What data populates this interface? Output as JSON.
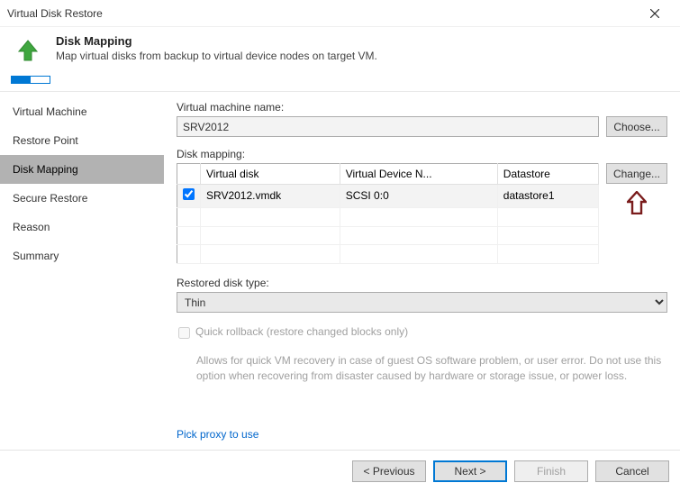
{
  "window": {
    "title": "Virtual Disk Restore"
  },
  "header": {
    "title": "Disk Mapping",
    "subtitle": "Map virtual disks from backup to virtual device nodes on target VM."
  },
  "sidebar": {
    "items": [
      {
        "label": "Virtual Machine"
      },
      {
        "label": "Restore Point"
      },
      {
        "label": "Disk Mapping"
      },
      {
        "label": "Secure Restore"
      },
      {
        "label": "Reason"
      },
      {
        "label": "Summary"
      }
    ],
    "active_index": 2
  },
  "content": {
    "vm_name_label": "Virtual machine name:",
    "vm_name_value": "SRV2012",
    "choose_label": "Choose...",
    "disk_mapping_label": "Disk mapping:",
    "table_headers": {
      "c0": "",
      "c1": "Virtual disk",
      "c2": "Virtual Device N...",
      "c3": "Datastore"
    },
    "rows": [
      {
        "checked": true,
        "disk": "SRV2012.vmdk",
        "node": "SCSI 0:0",
        "ds": "datastore1"
      }
    ],
    "change_label": "Change...",
    "restored_type_label": "Restored disk type:",
    "restored_type_value": "Thin",
    "quick_rollback_label": "Quick rollback (restore changed blocks only)",
    "quick_rollback_desc": "Allows for quick VM recovery in case of guest OS software problem, or user error. Do not use this option when recovering from disaster caused by hardware or storage issue, or power loss.",
    "proxy_link": "Pick proxy to use"
  },
  "footer": {
    "previous": "< Previous",
    "next": "Next >",
    "finish": "Finish",
    "cancel": "Cancel"
  }
}
